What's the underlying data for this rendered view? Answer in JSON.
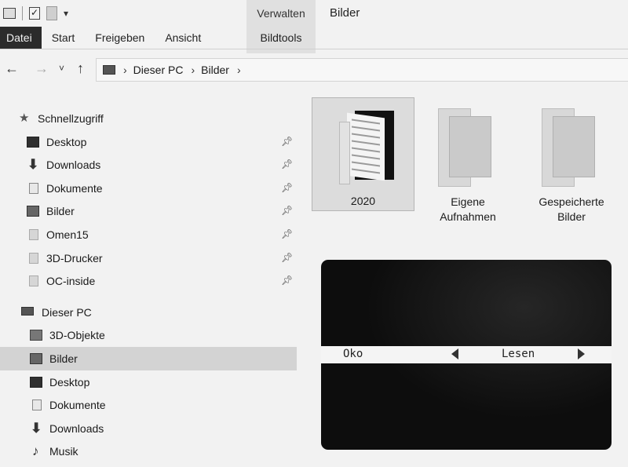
{
  "ribbon": {
    "context_label": "Verwalten",
    "window_title": "Bilder",
    "tabs": [
      "Datei",
      "Start",
      "Freigeben",
      "Ansicht"
    ],
    "context_tab": "Bildtools"
  },
  "address": {
    "crumbs": [
      "Dieser PC",
      "Bilder"
    ]
  },
  "sidebar": {
    "quick_access": "Schnellzugriff",
    "quick_items": [
      {
        "label": "Desktop",
        "icon": "desktop-icon"
      },
      {
        "label": "Downloads",
        "icon": "download-arrow-icon"
      },
      {
        "label": "Dokumente",
        "icon": "document-icon"
      },
      {
        "label": "Bilder",
        "icon": "pictures-icon"
      },
      {
        "label": "Omen15",
        "icon": "folder-icon"
      },
      {
        "label": "3D-Drucker",
        "icon": "folder-icon"
      },
      {
        "label": "OC-inside",
        "icon": "folder-icon"
      }
    ],
    "this_pc": "Dieser PC",
    "pc_items": [
      {
        "label": "3D-Objekte",
        "icon": "3d-objects-icon"
      },
      {
        "label": "Bilder",
        "icon": "pictures-icon"
      },
      {
        "label": "Desktop",
        "icon": "desktop-icon"
      },
      {
        "label": "Dokumente",
        "icon": "document-icon"
      },
      {
        "label": "Downloads",
        "icon": "download-arrow-icon"
      },
      {
        "label": "Musik",
        "icon": "music-note-icon"
      }
    ]
  },
  "content": {
    "folders": [
      {
        "name": "2020"
      },
      {
        "name_line1": "Eigene",
        "name_line2": "Aufnahmen"
      },
      {
        "name_line1": "Gespeicherte",
        "name_line2": "Bilder"
      }
    ]
  },
  "overlay": {
    "left_label": "Oko",
    "right_label": "Lesen"
  },
  "colors": {
    "background": "#f2f2f2",
    "file_tab": "#2b2b2b",
    "selection": "#d3d3d3",
    "overlay": "#0d0d0d"
  }
}
